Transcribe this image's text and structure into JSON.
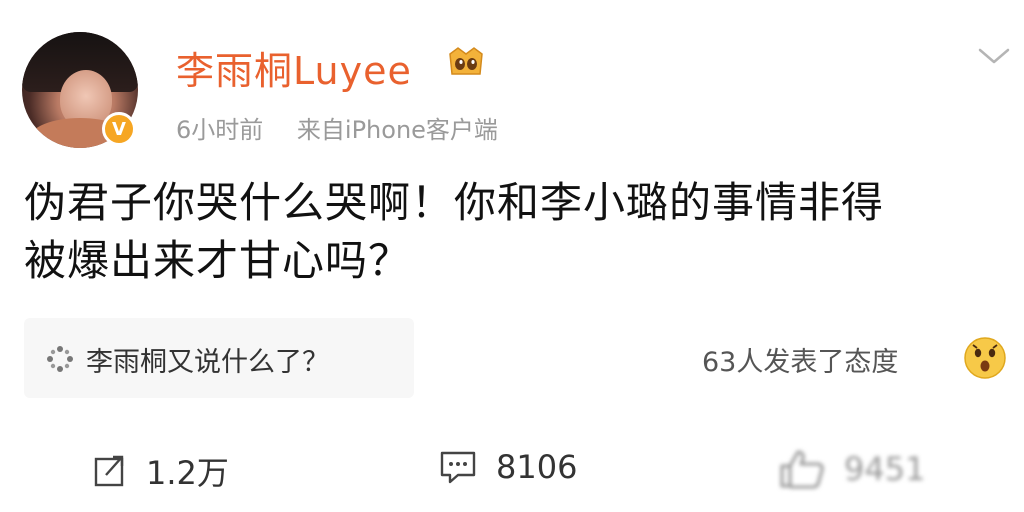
{
  "post": {
    "username": "李雨桐Luyee",
    "time": "6小时前",
    "source": "来自iPhone客户端",
    "text_line1": "伪君子你哭什么哭啊！你和李小璐的事情非得",
    "text_line2": "被爆出来才甘心吗？"
  },
  "topic": {
    "label": "李雨桐又说什么了？"
  },
  "reactions": {
    "summary": "63人发表了态度"
  },
  "actions": {
    "repost_count": "1.2万",
    "comment_count": "8106",
    "like_count": "9451"
  },
  "badge": {
    "verify_letter": "V"
  },
  "colors": {
    "username": "#e9612e",
    "badge": "#f6a623"
  }
}
